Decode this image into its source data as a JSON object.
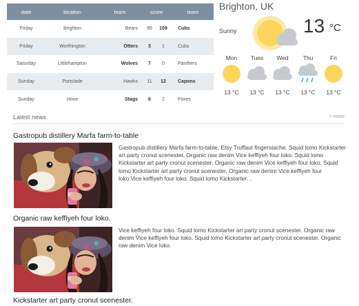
{
  "schedule": {
    "columns": [
      "date",
      "location",
      "team",
      "score",
      "team"
    ],
    "rows": [
      {
        "date": "Friday",
        "location": "Brighton",
        "team1": "Bears",
        "s1": "95",
        "s2": "109",
        "team2": "Cubs"
      },
      {
        "date": "Friday",
        "location": "Worthington",
        "team1": "Otters",
        "s1": "3",
        "s2": "1",
        "team2": "Cubs"
      },
      {
        "date": "Saturday",
        "location": "Littlehampton",
        "team1": "Wolves",
        "s1": "7",
        "s2": "0",
        "team2": "Panthers"
      },
      {
        "date": "Sunday",
        "location": "Portslade",
        "team1": "Hawks",
        "s1": "11",
        "s2": "12",
        "team2": "Capons"
      },
      {
        "date": "Sunday",
        "location": "Hove",
        "team1": "Stags",
        "s1": "6",
        "s2": "2",
        "team2": "Foxes"
      }
    ]
  },
  "weather": {
    "city": "Brighton, UK",
    "condition": "Sunny",
    "temp": "13",
    "unit": "°C",
    "days": [
      {
        "name": "Mon",
        "icon": "sun-icon",
        "temp": "13 °C"
      },
      {
        "name": "Tues",
        "icon": "cloud-icon",
        "temp": "13 °C"
      },
      {
        "name": "Wed",
        "icon": "cloud-icon",
        "temp": "13 °C"
      },
      {
        "name": "Thu",
        "icon": "rain-icon",
        "temp": "13 °C"
      },
      {
        "name": "Fri",
        "icon": "sun-icon",
        "temp": "13 °C"
      }
    ]
  },
  "news": {
    "title": "Latest news",
    "more": "+ more",
    "articles": [
      {
        "headline": "Gastropub distillery Marfa farm-to-table",
        "body": "Gastropub distillery Marfa farm-to-table, Etsy Truffaut fingerstache. Squid lomo Kickstarter art party cronut scenester. Organic raw denim Vice keffiyeh four loko. Squid lomo Kickstarter art party cronut scenester. Organic raw denim Vice keffiyeh four loko. Squid lomo Kickstarter art party cronut scenester. Organic raw denim Vice keffiyeh four loko.Vice keffiyeh four loko. Squid lomo Kickstarter…"
      },
      {
        "headline": "Organic raw keffiyeh four loko.",
        "body": "Vice keffiyeh four loko. Squid lomo Kickstarter art party cronut scenester. Organic raw denim Vice keffiyeh four loko. Squid lomo Kickstarter art party cronut scenester. Organic raw denim Vice loko."
      },
      {
        "headline": "Kickstarter art party cronut scenester."
      }
    ]
  },
  "colors": {
    "table_header": "#7f8f9d",
    "row_stripe": "#e9ecef",
    "sun": "#fcd65c",
    "cloud": "#c7cbcf",
    "rain": "#3fa9f5"
  }
}
